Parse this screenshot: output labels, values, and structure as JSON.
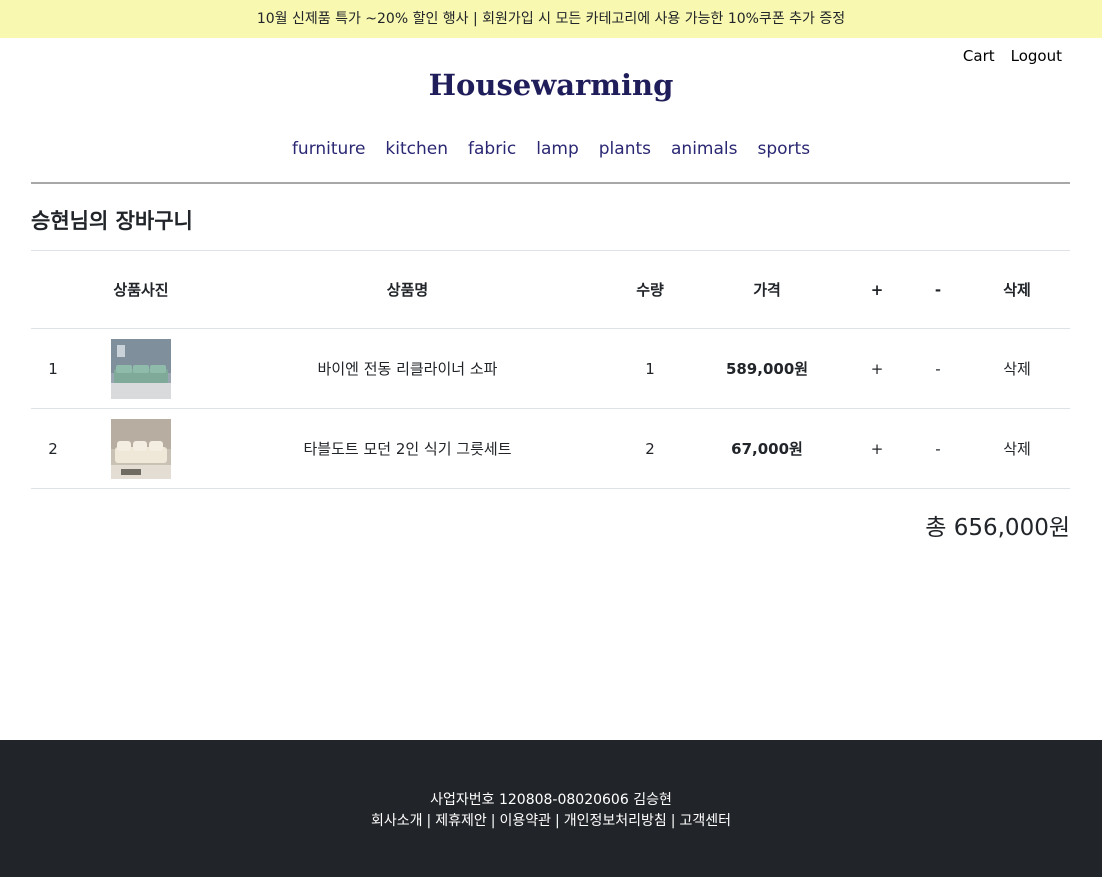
{
  "promo": {
    "text": "10월 신제품 특가 ~20% 할인 행사 | 회원가입 시 모든 카테고리에 사용 가능한 10%쿠폰 추가 증정"
  },
  "user_links": {
    "cart": "Cart",
    "logout": "Logout"
  },
  "logo": {
    "text": "Housewarming"
  },
  "nav": [
    "furniture",
    "kitchen",
    "fabric",
    "lamp",
    "plants",
    "animals",
    "sports"
  ],
  "cart": {
    "title": "승현님의 장바구니",
    "headers": {
      "index": "",
      "image": "상품사진",
      "name": "상품명",
      "qty": "수량",
      "price": "가격",
      "plus": "+",
      "minus": "-",
      "delete": "삭제"
    },
    "rows": [
      {
        "index": "1",
        "name": "바이엔 전동 리클라이너 소파",
        "qty": "1",
        "price": "589,000원",
        "plus": "+",
        "minus": "-",
        "delete": "삭제",
        "thumb_icon": "sofa-photo"
      },
      {
        "index": "2",
        "name": "타블도트 모던 2인 식기 그릇세트",
        "qty": "2",
        "price": "67,000원",
        "plus": "+",
        "minus": "-",
        "delete": "삭제",
        "thumb_icon": "sofa-photo"
      }
    ],
    "total": "총 656,000원"
  },
  "footer": {
    "business": "사업자번호 120808-08020606 김승현",
    "links": [
      "회사소개",
      "제휴제안",
      "이용약관",
      "개인정보처리방침",
      "고객센터"
    ],
    "separator": "|"
  },
  "colors": {
    "promo_bg": "#f8f8b0",
    "logo": "#1f1d5a",
    "nav": "#2b2873",
    "footer_bg": "#212529"
  }
}
